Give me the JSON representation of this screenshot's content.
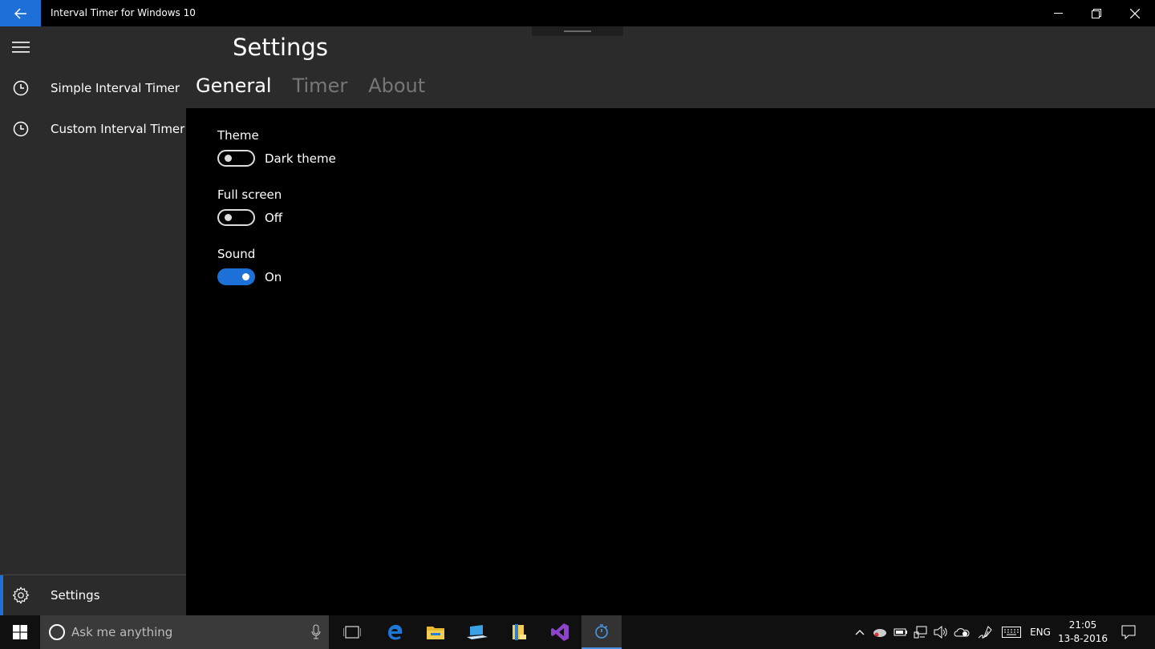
{
  "window": {
    "title": "Interval Timer for Windows 10"
  },
  "sidebar": {
    "items": [
      {
        "label": "Simple Interval Timer",
        "icon": "clock-icon"
      },
      {
        "label": "Custom Interval Timer",
        "icon": "clock-icon"
      }
    ],
    "settings_label": "Settings"
  },
  "page": {
    "title": "Settings",
    "tabs": [
      {
        "label": "General",
        "active": true
      },
      {
        "label": "Timer",
        "active": false
      },
      {
        "label": "About",
        "active": false
      }
    ]
  },
  "settings": {
    "theme": {
      "label": "Theme",
      "state_text": "Dark theme",
      "on": false
    },
    "fullscreen": {
      "label": "Full screen",
      "state_text": "Off",
      "on": false
    },
    "sound": {
      "label": "Sound",
      "state_text": "On",
      "on": true
    }
  },
  "taskbar": {
    "search_placeholder": "Ask me anything",
    "language": "ENG",
    "time": "21:05",
    "date": "13-8-2016"
  },
  "colors": {
    "accent": "#1e70d9",
    "sidebar_bg": "#2b2b2b",
    "content_bg": "#000000"
  }
}
